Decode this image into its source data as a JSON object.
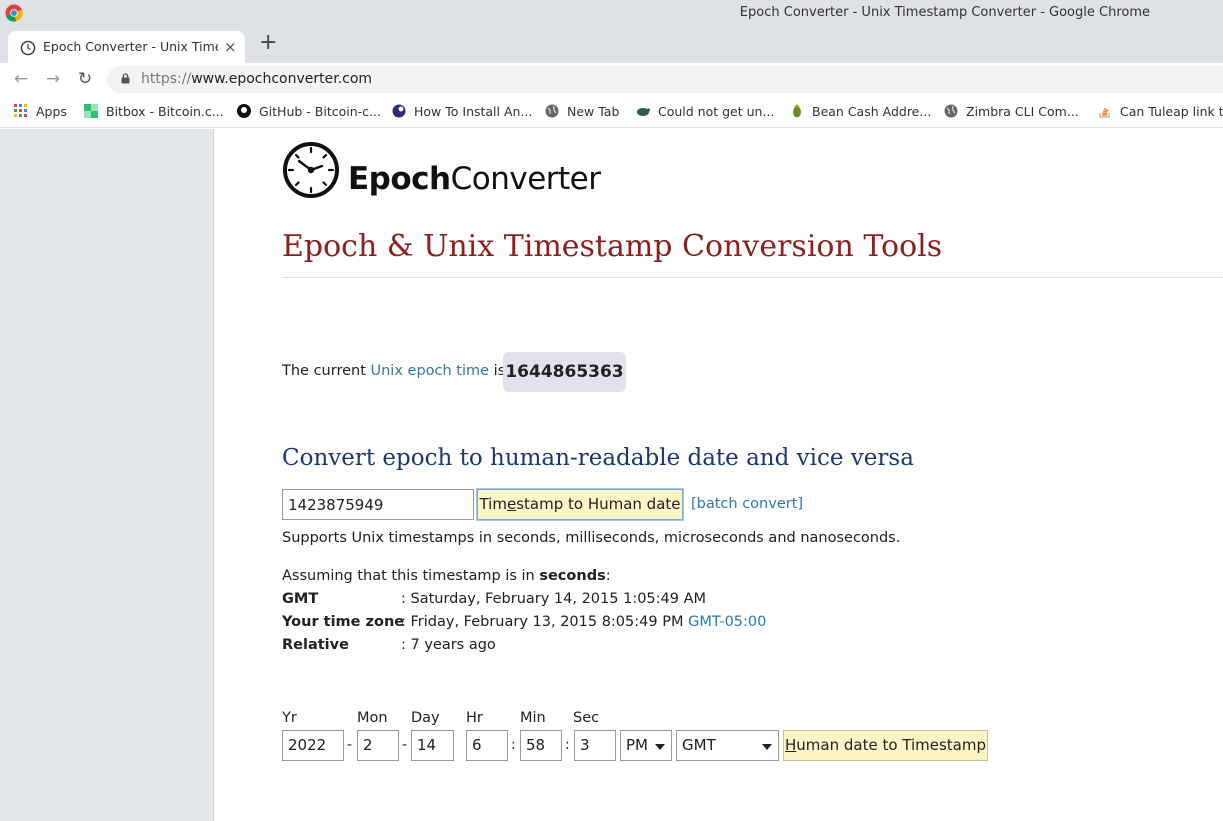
{
  "window": {
    "title": "Epoch Converter - Unix Timestamp Converter - Google Chrome"
  },
  "tab": {
    "label": "Epoch Converter - Unix Timestamp Converter",
    "close": "×",
    "new_tab": "+"
  },
  "address": {
    "scheme": "https://",
    "host": "www.epochconverter.com"
  },
  "bookmarks": [
    {
      "label": "Apps",
      "icon": "apps-grid-icon"
    },
    {
      "label": "Bitbox - Bitcoin.c...",
      "icon": "bitbox-icon"
    },
    {
      "label": "GitHub - Bitcoin-c...",
      "icon": "github-icon"
    },
    {
      "label": "How To Install An...",
      "icon": "site-icon"
    },
    {
      "label": "New Tab",
      "icon": "globe-icon"
    },
    {
      "label": "Could not get un...",
      "icon": "turtle-icon"
    },
    {
      "label": "Bean Cash Addre...",
      "icon": "bean-icon"
    },
    {
      "label": "Zimbra CLI Com...",
      "icon": "globe-icon"
    },
    {
      "label": "Can Tuleap link t...",
      "icon": "stackoverflow-icon"
    }
  ],
  "logo": {
    "part1": "Epoch",
    "part2": "Converter"
  },
  "heading": "Epoch & Unix Timestamp Conversion Tools",
  "current": {
    "prefix": "The current ",
    "link": "Unix epoch time",
    "suffix": " is",
    "value": "1644865363"
  },
  "convert": {
    "heading": "Convert epoch to human-readable date and vice versa",
    "input_value": "1423875949",
    "button_pre": "Tim",
    "button_ul": "e",
    "button_post": "stamp to Human date",
    "batch": "[batch convert]",
    "supports": "Supports Unix timestamps in seconds, milliseconds, microseconds and nanoseconds."
  },
  "result": {
    "assuming_pre": "Assuming that this timestamp is in ",
    "assuming_unit": "seconds",
    "assuming_post": ":",
    "rows": [
      {
        "key": "GMT",
        "value": ": Saturday, February 14, 2015 1:05:49 AM",
        "extra": ""
      },
      {
        "key": "Your time zone",
        "value": ": Friday, February 13, 2015 8:05:49 PM ",
        "extra": "GMT-05:00"
      },
      {
        "key": "Relative",
        "value": ": 7 years ago",
        "extra": ""
      }
    ]
  },
  "human": {
    "labels": {
      "yr": "Yr",
      "mon": "Mon",
      "day": "Day",
      "hr": "Hr",
      "min": "Min",
      "sec": "Sec"
    },
    "values": {
      "yr": "2022",
      "mon": "2",
      "day": "14",
      "hr": "6",
      "min": "58",
      "sec": "3"
    },
    "date_sep": "-",
    "time_sep": ":",
    "ampm": "PM",
    "tz": "GMT",
    "button_ul": "H",
    "button_rest": "uman date to Timestamp"
  },
  "colors": {
    "heading": "#8b2222",
    "subheading": "#1a3a6b",
    "link": "#2a7ab0",
    "button": "#fdf4c5",
    "badge": "#e3e1ee"
  }
}
